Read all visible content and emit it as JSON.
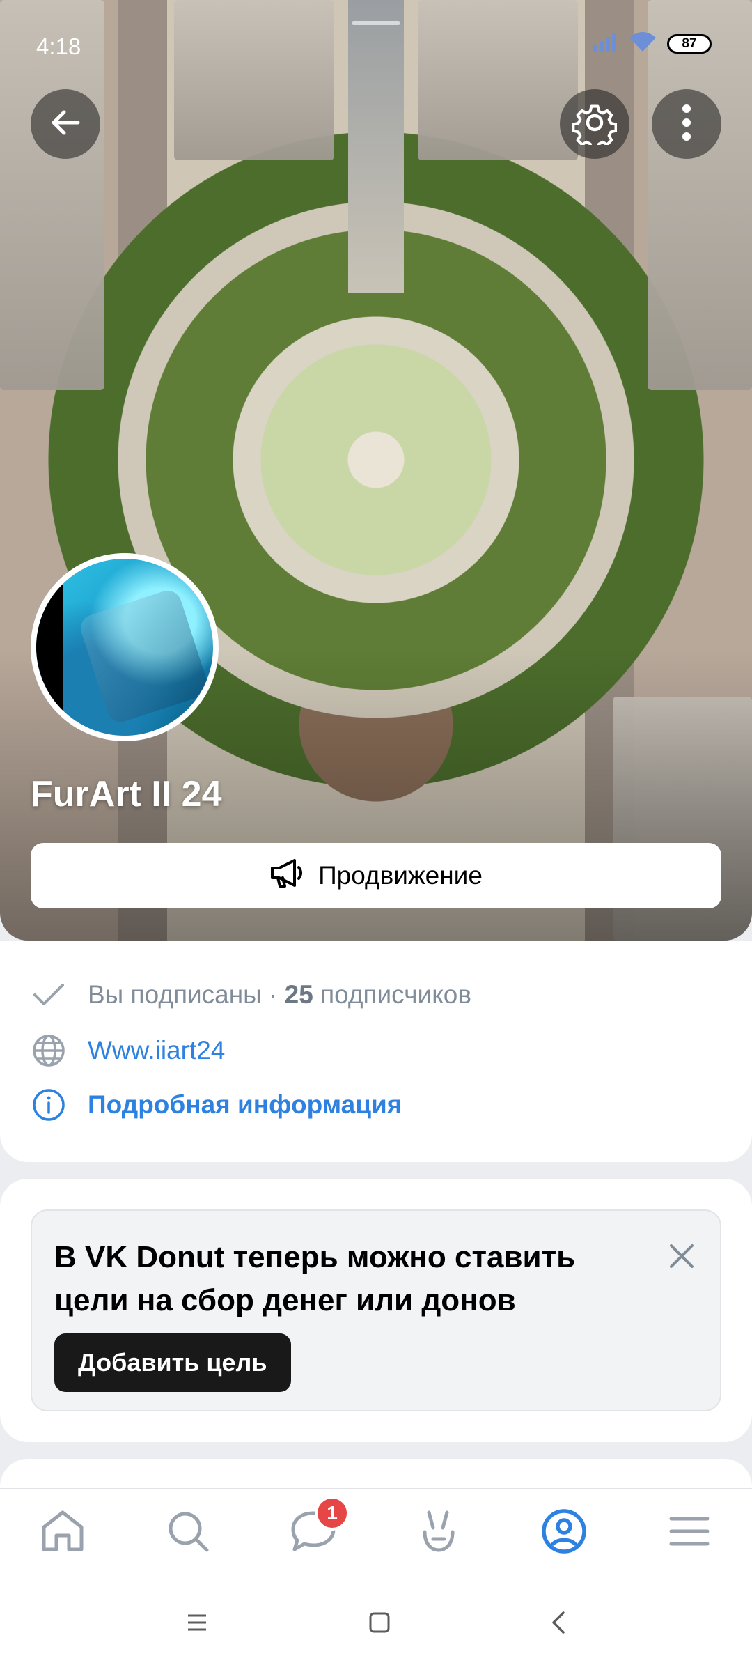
{
  "status_bar": {
    "time": "4:18",
    "battery": "87"
  },
  "header": {
    "back_icon": "arrow-left-icon",
    "settings_icon": "gear-icon",
    "more_icon": "more-vertical-icon"
  },
  "community": {
    "name": "FurArt II 24",
    "promote_label": "Продвижение"
  },
  "info": {
    "subscribed_text": "Вы подписаны",
    "separator": " · ",
    "subscribers_count": "25",
    "subscribers_label": " подписчиков",
    "website": "Www.iiart24",
    "details_label": "Подробная информация"
  },
  "donut_banner": {
    "title": "В VK Donut теперь можно ставить цели на сбор денег или донов",
    "button_label": "Добавить цель"
  },
  "bottom_nav": {
    "items": [
      {
        "name": "home",
        "icon": "home-icon"
      },
      {
        "name": "search",
        "icon": "search-icon"
      },
      {
        "name": "messages",
        "icon": "chat-icon",
        "badge": "1"
      },
      {
        "name": "clips",
        "icon": "clips-icon"
      },
      {
        "name": "profile",
        "icon": "profile-icon",
        "active": true
      },
      {
        "name": "menu",
        "icon": "menu-icon"
      }
    ]
  },
  "colors": {
    "accent": "#2d81e0",
    "badge": "#e64646",
    "muted_text": "#818c99",
    "dark_button": "#19191a"
  }
}
